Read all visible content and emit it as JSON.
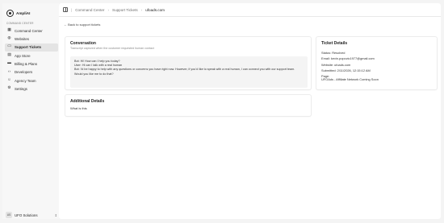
{
  "sidebar": {
    "brand": "AmpliAI",
    "section_label": "COMMAND CENTER",
    "items": [
      {
        "label": "Command Center",
        "icon": "grid-icon"
      },
      {
        "label": "Websites",
        "icon": "globe-icon"
      },
      {
        "label": "Support Tickets",
        "icon": "ticket-icon",
        "active": true
      },
      {
        "label": "App Store",
        "icon": "store-icon"
      },
      {
        "label": "Billing & Plans",
        "icon": "card-icon"
      },
      {
        "label": "Developers",
        "icon": "code-icon"
      },
      {
        "label": "Agency Team",
        "icon": "team-icon"
      },
      {
        "label": "Settings",
        "icon": "gear-icon"
      }
    ],
    "org": {
      "initials": "US",
      "name": "UFO Solutions"
    }
  },
  "breadcrumb": {
    "items": [
      "Command Center",
      "Support Tickets",
      "ufoads.com"
    ]
  },
  "back_link": "← Back to support tickets",
  "conversation": {
    "title": "Conversation",
    "subtitle": "Transcript captured when the customer requested human contact",
    "lines": [
      "Bot: Hi! How can I help you today?",
      "User: Hi can I talk with a real human",
      "Bot: I'd be happy to help with any questions or concerns you have right now. However, if you'd like to speak with a real human, I can connect you with our support team. Would you like me to do that?"
    ]
  },
  "additional": {
    "title": "Additional Details",
    "text": "What is this"
  },
  "ticket": {
    "title": "Ticket Details",
    "status": "Status: Resolved",
    "email": "Email: kevin.popovic1977@gmail.com",
    "website": "Website: ufoads.com",
    "submitted": "Submitted: 2/11/2026, 12:15:12 AM",
    "page": "Page:\nUFOAds - Affiliate Network Coming Soon"
  }
}
